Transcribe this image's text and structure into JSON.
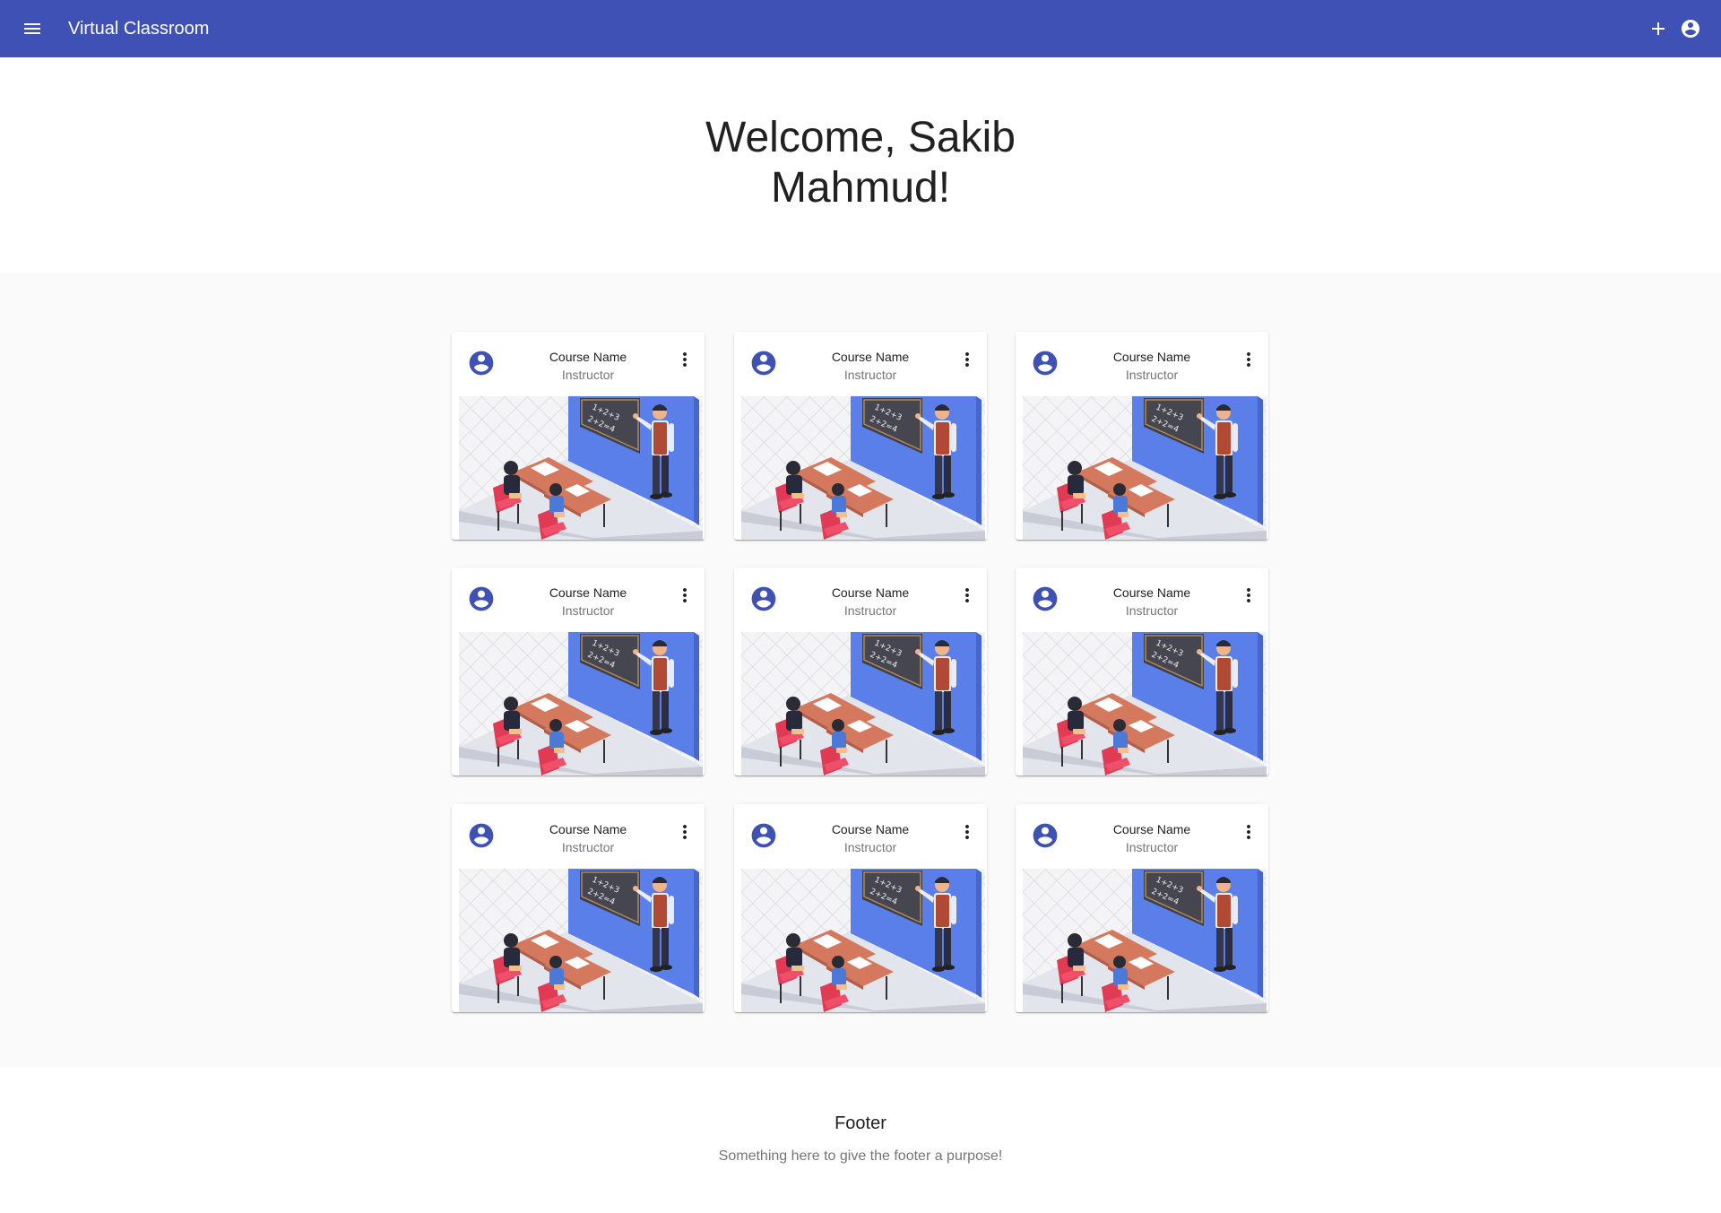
{
  "app": {
    "title": "Virtual Classroom",
    "brand_color": "#3f51b5"
  },
  "toolbar": {
    "menu_icon": "menu-icon",
    "add_icon": "add-icon",
    "account_icon": "account-circle-icon"
  },
  "welcome": {
    "line1": "Welcome, Sakib",
    "line2": "Mahmud!"
  },
  "courses": [
    {
      "title": "Course Name",
      "subtitle": "Instructor"
    },
    {
      "title": "Course Name",
      "subtitle": "Instructor"
    },
    {
      "title": "Course Name",
      "subtitle": "Instructor"
    },
    {
      "title": "Course Name",
      "subtitle": "Instructor"
    },
    {
      "title": "Course Name",
      "subtitle": "Instructor"
    },
    {
      "title": "Course Name",
      "subtitle": "Instructor"
    },
    {
      "title": "Course Name",
      "subtitle": "Instructor"
    },
    {
      "title": "Course Name",
      "subtitle": "Instructor"
    },
    {
      "title": "Course Name",
      "subtitle": "Instructor"
    }
  ],
  "board_text": {
    "line1": "1+2+3",
    "line2": "2+2=4"
  },
  "footer": {
    "title": "Footer",
    "text": "Something here to give the footer a purpose!"
  }
}
